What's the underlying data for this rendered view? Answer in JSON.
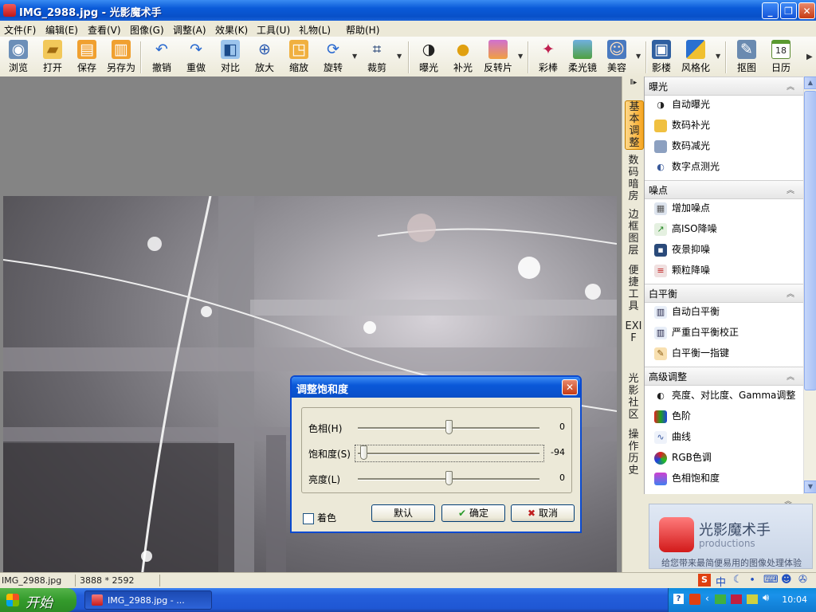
{
  "window": {
    "title": "IMG_2988.jpg - 光影魔术手",
    "minimize": "_",
    "restore": "❐",
    "close": "✕"
  },
  "menu": [
    "文件(F)",
    "编辑(E)",
    "查看(V)",
    "图像(G)",
    "调整(A)",
    "效果(K)",
    "工具(U)",
    "礼物(L)",
    "帮助(H)"
  ],
  "toolbar": [
    {
      "label": "浏览",
      "icon": "eye-icon"
    },
    {
      "label": "打开",
      "icon": "folder-icon"
    },
    {
      "label": "保存",
      "icon": "save-icon"
    },
    {
      "label": "另存为",
      "icon": "save-as-icon"
    },
    {
      "label": "撤销",
      "icon": "undo-icon"
    },
    {
      "label": "重做",
      "icon": "redo-icon"
    },
    {
      "label": "对比",
      "icon": "compare-icon"
    },
    {
      "label": "放大",
      "icon": "zoom-in-icon"
    },
    {
      "label": "缩放",
      "icon": "resize-icon"
    },
    {
      "label": "旋转",
      "icon": "rotate-icon"
    },
    {
      "label": "裁剪",
      "icon": "crop-icon"
    },
    {
      "label": "曝光",
      "icon": "exposure-icon"
    },
    {
      "label": "补光",
      "icon": "fill-light-icon"
    },
    {
      "label": "反转片",
      "icon": "slide-film-icon"
    },
    {
      "label": "彩棒",
      "icon": "color-wand-icon"
    },
    {
      "label": "柔光镜",
      "icon": "soft-light-icon"
    },
    {
      "label": "美容",
      "icon": "beauty-icon"
    },
    {
      "label": "影楼",
      "icon": "studio-icon"
    },
    {
      "label": "风格化",
      "icon": "stylize-icon"
    },
    {
      "label": "抠图",
      "icon": "cutout-icon"
    },
    {
      "label": "日历",
      "icon": "calendar-icon"
    }
  ],
  "calendar_day": "18",
  "side_tabs": [
    "基本调整",
    "数码暗房",
    "边框图层",
    "便捷工具",
    "EXIF",
    "光影社区",
    "操作历史"
  ],
  "panel": {
    "sections": [
      {
        "title": "曝光",
        "items": [
          "自动曝光",
          "数码补光",
          "数码减光",
          "数字点测光"
        ]
      },
      {
        "title": "噪点",
        "items": [
          "增加噪点",
          "高ISO降噪",
          "夜景抑噪",
          "颗粒降噪"
        ]
      },
      {
        "title": "白平衡",
        "items": [
          "自动白平衡",
          "严重白平衡校正",
          "白平衡一指键"
        ]
      },
      {
        "title": "高级调整",
        "items": [
          "亮度、对比度、Gamma调整",
          "色阶",
          "曲线",
          "RGB色调",
          "色相饱和度"
        ]
      }
    ]
  },
  "promo": {
    "brand": "光影魔术手",
    "sub": "productions",
    "slogan": "给您带来最简便易用的图像处理体验"
  },
  "dialog": {
    "title": "调整饱和度",
    "sliders": [
      {
        "label": "色相(H)",
        "value": "0",
        "pos": 0.5
      },
      {
        "label": "饱和度(S)",
        "value": "-94",
        "pos": 0.03
      },
      {
        "label": "亮度(L)",
        "value": "0",
        "pos": 0.5
      }
    ],
    "colorize_label": "着色",
    "default_btn": "默认",
    "ok_btn": "确定",
    "cancel_btn": "取消"
  },
  "status": {
    "filename": "IMG_2988.jpg",
    "dimensions": "3888 * 2592"
  },
  "taskbar": {
    "start": "开始",
    "task": "IMG_2988.jpg - ...",
    "clock": "10:04",
    "ime": "中"
  }
}
